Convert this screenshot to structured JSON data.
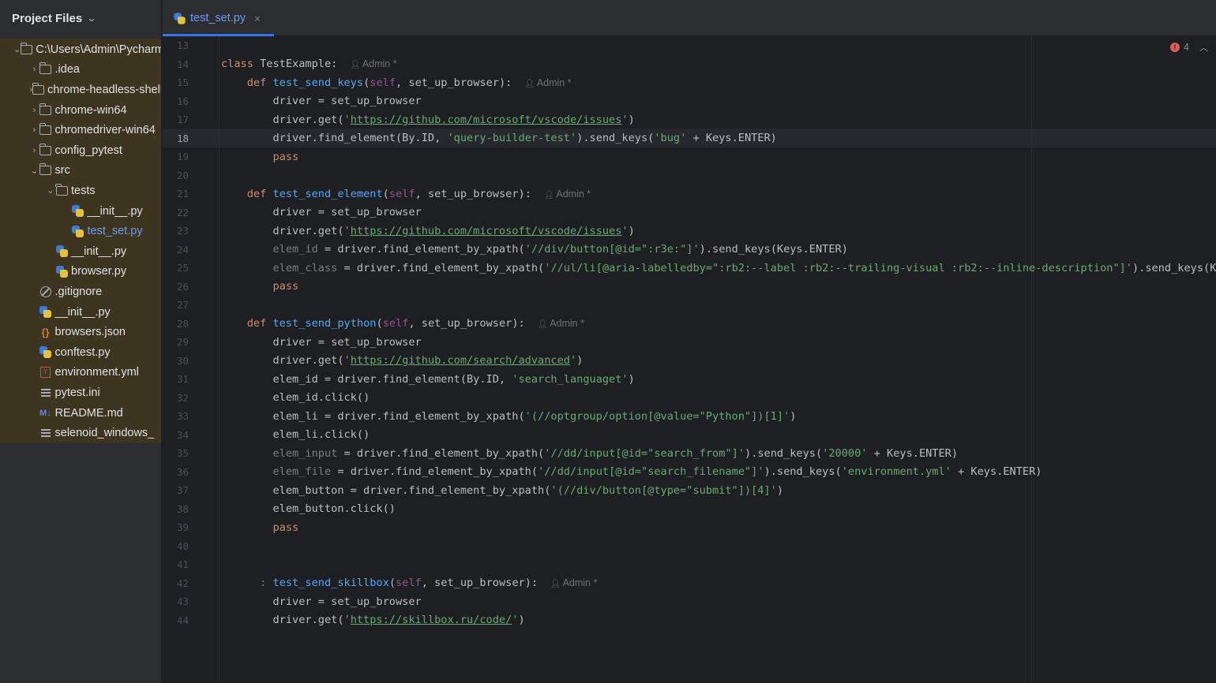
{
  "sidebar": {
    "title": "Project Files",
    "tree": [
      {
        "label": "C:\\Users\\Admin\\PycharmProjects",
        "icon": "folder-icon",
        "arrow": "down",
        "indent": 0
      },
      {
        "label": ".idea",
        "icon": "folder-icon",
        "arrow": "right",
        "indent": 1
      },
      {
        "label": "chrome-headless-shell",
        "icon": "folder-icon",
        "arrow": "right",
        "indent": 1
      },
      {
        "label": "chrome-win64",
        "icon": "folder-icon",
        "arrow": "right",
        "indent": 1
      },
      {
        "label": "chromedriver-win64",
        "icon": "folder-icon",
        "arrow": "right",
        "indent": 1
      },
      {
        "label": "config_pytest",
        "icon": "folder-icon",
        "arrow": "right",
        "indent": 1
      },
      {
        "label": "src",
        "icon": "folder-icon",
        "arrow": "down",
        "indent": 1
      },
      {
        "label": "tests",
        "icon": "folder-icon",
        "arrow": "down",
        "indent": 2
      },
      {
        "label": "__init__.py",
        "icon": "python-file-icon",
        "arrow": "",
        "indent": 3
      },
      {
        "label": "test_set.py",
        "icon": "python-file-icon",
        "arrow": "",
        "indent": 3,
        "selected": true
      },
      {
        "label": "__init__.py",
        "icon": "python-file-icon",
        "arrow": "",
        "indent": 2
      },
      {
        "label": "browser.py",
        "icon": "python-file-icon",
        "arrow": "",
        "indent": 2
      },
      {
        "label": ".gitignore",
        "icon": "ignore-file-icon",
        "arrow": "",
        "indent": 1
      },
      {
        "label": "__init__.py",
        "icon": "python-file-icon",
        "arrow": "",
        "indent": 1
      },
      {
        "label": "browsers.json",
        "icon": "json-file-icon",
        "arrow": "",
        "indent": 1
      },
      {
        "label": "conftest.py",
        "icon": "python-file-icon",
        "arrow": "",
        "indent": 1
      },
      {
        "label": "environment.yml",
        "icon": "yaml-file-icon",
        "arrow": "",
        "indent": 1
      },
      {
        "label": "pytest.ini",
        "icon": "text-file-icon",
        "arrow": "",
        "indent": 1
      },
      {
        "label": "README.md",
        "icon": "markdown-file-icon",
        "arrow": "",
        "indent": 1
      },
      {
        "label": "selenoid_windows_",
        "icon": "text-file-icon",
        "arrow": "",
        "indent": 1
      }
    ]
  },
  "tabs": [
    {
      "label": "test_set.py",
      "active": true,
      "close": "×"
    }
  ],
  "editor": {
    "current_line": 18,
    "problems_count": "4",
    "lines": [
      {
        "n": "13",
        "tokens": []
      },
      {
        "n": "14",
        "tokens": [
          [
            "kw",
            "class "
          ],
          [
            "",
            "TestExample:"
          ]
        ],
        "author": "Admin *"
      },
      {
        "n": "15",
        "tokens": [
          [
            "",
            "    "
          ],
          [
            "kw",
            "def "
          ],
          [
            "fn",
            "test_send_keys"
          ],
          [
            "",
            "("
          ],
          [
            "self",
            "self"
          ],
          [
            "",
            ", set_up_browser):"
          ]
        ],
        "author": "Admin *"
      },
      {
        "n": "16",
        "tokens": [
          [
            "",
            "        driver = set_up_browser"
          ]
        ]
      },
      {
        "n": "17",
        "tokens": [
          [
            "",
            "        driver.get("
          ],
          [
            "str",
            "'"
          ],
          [
            "url",
            "https://github.com/microsoft/vscode/issues"
          ],
          [
            "str",
            "'"
          ],
          [
            "",
            ")"
          ]
        ]
      },
      {
        "n": "18",
        "tokens": [
          [
            "",
            "        driver.find_element(By.ID, "
          ],
          [
            "str",
            "'query-builder-test'"
          ],
          [
            "",
            ").send_keys("
          ],
          [
            "str",
            "'bug'"
          ],
          [
            "",
            " + Keys.ENTER)"
          ]
        ]
      },
      {
        "n": "19",
        "tokens": [
          [
            "",
            "        "
          ],
          [
            "kw",
            "pass"
          ]
        ]
      },
      {
        "n": "20",
        "tokens": []
      },
      {
        "n": "21",
        "tokens": [
          [
            "",
            "    "
          ],
          [
            "kw",
            "def "
          ],
          [
            "fn",
            "test_send_element"
          ],
          [
            "",
            "("
          ],
          [
            "self",
            "self"
          ],
          [
            "",
            ", set_up_browser):"
          ]
        ],
        "author": "Admin *"
      },
      {
        "n": "22",
        "tokens": [
          [
            "",
            "        driver = set_up_browser"
          ]
        ]
      },
      {
        "n": "23",
        "tokens": [
          [
            "",
            "        driver.get("
          ],
          [
            "str",
            "'"
          ],
          [
            "url",
            "https://github.com/microsoft/vscode/issues"
          ],
          [
            "str",
            "'"
          ],
          [
            "",
            ")"
          ]
        ]
      },
      {
        "n": "24",
        "tokens": [
          [
            "",
            "        "
          ],
          [
            "dim",
            "elem_id"
          ],
          [
            "",
            " = driver.find_element_by_xpath("
          ],
          [
            "str",
            "'//div/button[@id=\":r3e:\"]'"
          ],
          [
            "",
            ").send_keys(Keys.ENTER)"
          ]
        ]
      },
      {
        "n": "25",
        "tokens": [
          [
            "",
            "        "
          ],
          [
            "dim",
            "elem_class"
          ],
          [
            "",
            " = driver.find_element_by_xpath("
          ],
          [
            "str",
            "'//ul/li[@aria-labelledby=\":rb2:--label :rb2:--trailing-visual :rb2:--inline-description\"]'"
          ],
          [
            "",
            ").send_keys(Keys.ENTER)"
          ]
        ]
      },
      {
        "n": "26",
        "tokens": [
          [
            "",
            "        "
          ],
          [
            "kw",
            "pass"
          ]
        ]
      },
      {
        "n": "27",
        "tokens": []
      },
      {
        "n": "28",
        "tokens": [
          [
            "",
            "    "
          ],
          [
            "kw",
            "def "
          ],
          [
            "fn",
            "test_send_python"
          ],
          [
            "",
            "("
          ],
          [
            "self",
            "self"
          ],
          [
            "",
            ", set_up_browser):"
          ]
        ],
        "author": "Admin *"
      },
      {
        "n": "29",
        "tokens": [
          [
            "",
            "        driver = set_up_browser"
          ]
        ]
      },
      {
        "n": "30",
        "tokens": [
          [
            "",
            "        driver.get("
          ],
          [
            "str",
            "'"
          ],
          [
            "url",
            "https://github.com/search/advanced"
          ],
          [
            "str",
            "'"
          ],
          [
            "",
            ")"
          ]
        ]
      },
      {
        "n": "31",
        "tokens": [
          [
            "",
            "        elem_id = driver.find_element(By.ID, "
          ],
          [
            "str",
            "'search_languaget'"
          ],
          [
            "",
            ")"
          ]
        ]
      },
      {
        "n": "32",
        "tokens": [
          [
            "",
            "        elem_id.click()"
          ]
        ]
      },
      {
        "n": "33",
        "tokens": [
          [
            "",
            "        elem_li = driver.find_element_by_xpath("
          ],
          [
            "str",
            "'(//optgroup/option[@value=\"Python\"])[1]'"
          ],
          [
            "",
            ")"
          ]
        ]
      },
      {
        "n": "34",
        "tokens": [
          [
            "",
            "        elem_li.click()"
          ]
        ]
      },
      {
        "n": "35",
        "tokens": [
          [
            "",
            "        "
          ],
          [
            "dim",
            "elem_input"
          ],
          [
            "",
            " = driver.find_element_by_xpath("
          ],
          [
            "str",
            "'//dd/input[@id=\"search_from\"]'"
          ],
          [
            "",
            ").send_keys("
          ],
          [
            "str",
            "'20000'"
          ],
          [
            "",
            " + Keys.ENTER)"
          ]
        ]
      },
      {
        "n": "36",
        "tokens": [
          [
            "",
            "        "
          ],
          [
            "dim",
            "elem_file"
          ],
          [
            "",
            " = driver.find_element_by_xpath("
          ],
          [
            "str",
            "'//dd/input[@id=\"search_filename\"]'"
          ],
          [
            "",
            ").send_keys("
          ],
          [
            "str",
            "'environment.yml'"
          ],
          [
            "",
            " + Keys.ENTER)"
          ]
        ]
      },
      {
        "n": "37",
        "tokens": [
          [
            "",
            "        elem_button = driver.find_element_by_xpath("
          ],
          [
            "str",
            "'(//div/button[@type=\"submit\"])[4]'"
          ],
          [
            "",
            ")"
          ]
        ]
      },
      {
        "n": "38",
        "tokens": [
          [
            "",
            "        elem_button.click()"
          ]
        ]
      },
      {
        "n": "39",
        "tokens": [
          [
            "",
            "        "
          ],
          [
            "kw",
            "pass"
          ]
        ]
      },
      {
        "n": "40",
        "tokens": []
      },
      {
        "n": "41",
        "tokens": []
      },
      {
        "n": "42",
        "tokens": [
          [
            "",
            "      "
          ],
          [
            "dim",
            ": "
          ],
          [
            "fn",
            "test_send_skillbox"
          ],
          [
            "",
            "("
          ],
          [
            "self",
            "self"
          ],
          [
            "",
            ", set_up_browser):"
          ]
        ],
        "author": "Admin *"
      },
      {
        "n": "43",
        "tokens": [
          [
            "",
            "        driver = set_up_browser"
          ]
        ]
      },
      {
        "n": "44",
        "tokens": [
          [
            "",
            "        driver.get("
          ],
          [
            "str",
            "'"
          ],
          [
            "url",
            "https://skillbox.ru/code/"
          ],
          [
            "str",
            "'"
          ],
          [
            "",
            ")"
          ]
        ]
      }
    ]
  },
  "colors": {
    "keyword": "#cf8e6d",
    "function": "#56a8f5",
    "self": "#94558d",
    "string": "#6aab73",
    "accent": "#3574f0",
    "error": "#db5c5c"
  }
}
